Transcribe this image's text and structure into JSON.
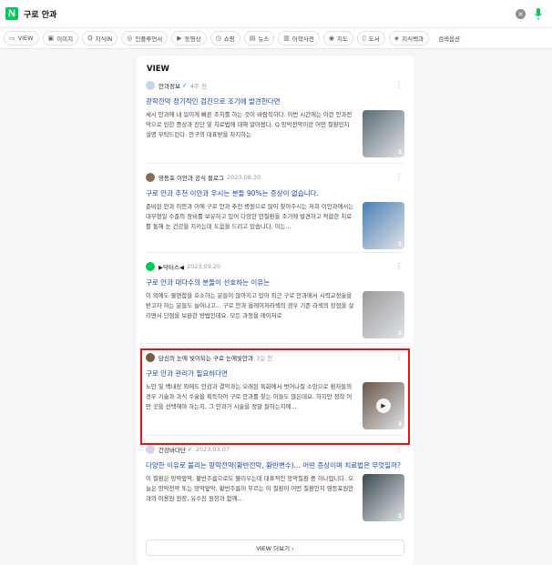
{
  "search": {
    "logo": "N",
    "query": "구로 안과",
    "clear": "×"
  },
  "tabs": [
    {
      "icon": "view-icon",
      "glyph": "▭",
      "label": "VIEW"
    },
    {
      "icon": "image-icon",
      "glyph": "▣",
      "label": "이미지"
    },
    {
      "icon": "kin-icon",
      "glyph": "Q",
      "label": "지식iN"
    },
    {
      "icon": "influencer-icon",
      "glyph": "◎",
      "label": "인플루언서"
    },
    {
      "icon": "video-icon",
      "glyph": "▶",
      "label": "동영상"
    },
    {
      "icon": "shopping-icon",
      "glyph": "◷",
      "label": "쇼핑"
    },
    {
      "icon": "news-icon",
      "glyph": "▤",
      "label": "뉴스"
    },
    {
      "icon": "dictionary-icon",
      "glyph": "▥",
      "label": "어학사전"
    },
    {
      "icon": "map-icon",
      "glyph": "◉",
      "label": "지도"
    },
    {
      "icon": "book-icon",
      "glyph": "▯",
      "label": "도서"
    },
    {
      "icon": "encyclopedia-icon",
      "glyph": "◈",
      "label": "지식백과"
    },
    {
      "icon": "",
      "glyph": "",
      "label": "검색옵션"
    }
  ],
  "section": {
    "title": "VIEW",
    "more_label": "VIEW 더보기 ›"
  },
  "results": [
    {
      "author": "안과정보",
      "verified": true,
      "date": "4주 전",
      "avatar_color": "#c9d6e6",
      "title": "광학전막 정기적인 검진으로 조기에 발견한다면",
      "desc": "세시 안과에 내 일이게 빠른 조치를 하는 것이 바람직하다. 이번 시간에는 이런 안과전막으로 인한 증상과 진단 및 치료법에 대해 알아봅다. Q.망막전막이란 어떤 질환인지 설명 부탁드린다. 안구의 대표받을 차지하는",
      "thumb_count": "1",
      "thumb_color": "#5b6b74",
      "video": false
    },
    {
      "author": "영등포 이안과 공식 블로그",
      "verified": false,
      "date": "2023.08.30",
      "avatar_color": "#8a6d4f",
      "title": "구로 안과 추천 이안과 우시는 분들 90%는 증상이 없습니다.",
      "desc": "준비된 안과 이안과 이에 구로 안과 추천 병원으로 많이 찾아주시는 저희 이안과에서는 대부형일 수준의 장비를 보유하고 있어 다양한 안질환을 조기에 발견하고 적합한 치료를 통해 눈 건강을 지키는데 도움을 드리고 있습니다. 이는...",
      "thumb_count": "3",
      "thumb_color": "#4a7fb5",
      "video": false
    },
    {
      "author": "▶닥터스◀",
      "verified": false,
      "date": "2023.09.20",
      "avatar_color": "#03c75a",
      "title": "구로 안과 대다수의 분들이 선호하는 이유는",
      "desc": "이 외에도 불편함을 호소하는 분들이 많아지고 있어 최근 구로 안과에서 시력교정술을 받고자 하는 분들도 늘어나고... 구로 안과 올레이저라섹의 경우 기존 라섹의 장점을 살리면서 단점을 보완한 방법인데요. 모든 과정을 레이저로",
      "thumb_count": "3",
      "thumb_color": "#9a9a9a",
      "video": false
    },
    {
      "author": "당신의 눈에 빛이되는 구로 눈에빛안과",
      "verified": false,
      "date": "3일 전",
      "avatar_color": "#7a5a4a",
      "title": "구로 안과 관리가 필요하다면",
      "desc": "노안 및 백내장 외에도 안검과 결막과는 오래된 특화에서 벗어나질 소망으로 환자들의 경우 기술과 과식 수술을 획득하여 구로 안과를 찾는 이들도 많은데요. 하지만 정작 어떤 곳을 선택해야 하는지, 그 안과가 시술을 정말 잘하는지에...",
      "thumb_count": "3",
      "thumb_color": "#6b5748",
      "video": true
    },
    {
      "author": "건강바다단",
      "verified": true,
      "date": "2023.03.07",
      "avatar_color": "#d9d2e9",
      "title": "다양한 이유로 불리는 망막전막(황반전막, 황반변수)... 어떤 증상이며 치료법은 무엇일까?",
      "desc": "이 질환은 망막앞막, 황반주름으로도 불리우는데 대표적인 망막질환 중 하나입니다. 오늘은 망막전막 또는 망막앞막, 황반주름이 부르는 이 질환이 어떤 질환인지 영등포원안과의 이용원 원장, 유수진 원장과 함께...",
      "thumb_count": "1",
      "thumb_color": "#3c4a52",
      "video": false
    }
  ],
  "colors": {
    "brand": "#03c75a",
    "link": "#1947b5",
    "highlight": "#e5121b"
  }
}
